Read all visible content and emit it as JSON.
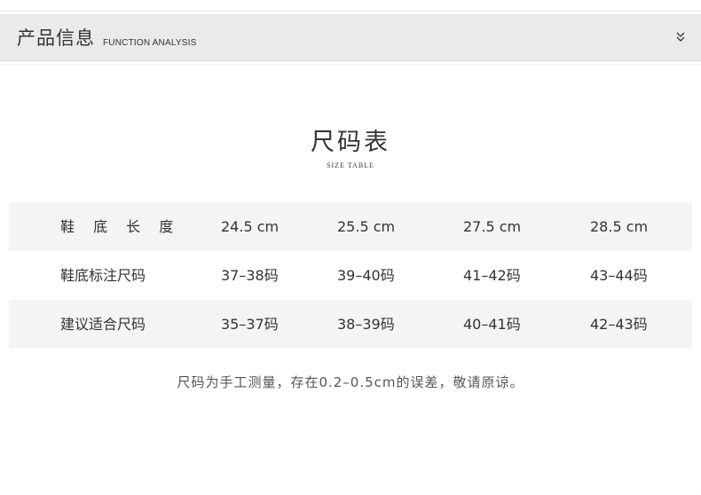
{
  "header": {
    "title": "产品信息",
    "subtitle": "FUNCTION ANALYSIS",
    "toggle_icon": "double-chevron-down-icon"
  },
  "section": {
    "title": "尺码表",
    "subtitle": "SIZE TABLE"
  },
  "size_table": {
    "rows": [
      {
        "label": "鞋 底 长 度",
        "values": [
          "24.5 cm",
          "25.5 cm",
          "27.5 cm",
          "28.5 cm"
        ]
      },
      {
        "label": "鞋底标注尺码",
        "values": [
          "37–38码",
          "39–40码",
          "41–42码",
          "43–44码"
        ]
      },
      {
        "label": "建议适合尺码",
        "values": [
          "35–37码",
          "38–39码",
          "40–41码",
          "42–43码"
        ]
      }
    ]
  },
  "footnote": "尺码为手工测量，存在0.2–0.5cm的误差，敬请原谅。",
  "colors": {
    "header_bg": "#eaeaea",
    "row_shade": "#f4f4f4",
    "text": "#333333"
  }
}
